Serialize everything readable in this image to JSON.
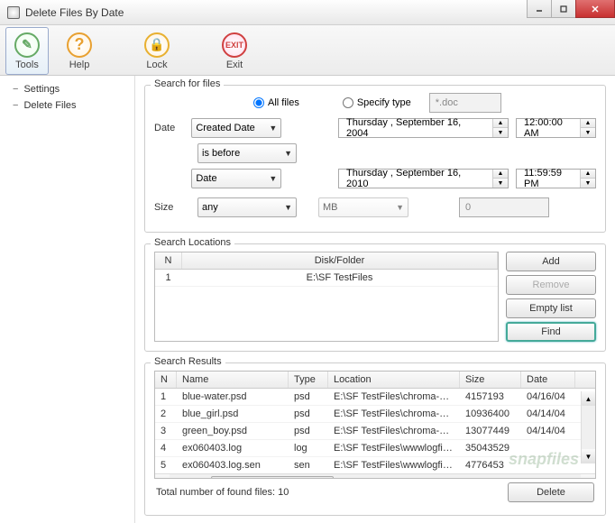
{
  "window": {
    "title": "Delete Files By Date"
  },
  "toolbar": {
    "tools": "Tools",
    "help": "Help",
    "lock": "Lock",
    "exit": "Exit",
    "help_glyph": "?",
    "exit_glyph": "EXIT"
  },
  "sidebar": {
    "settings": "Settings",
    "delete_files": "Delete Files"
  },
  "search": {
    "group_label": "Search for files",
    "radio_all": "All files",
    "radio_type": "Specify type",
    "type_value": "*.doc",
    "date_label": "Date",
    "date_field": "Created Date",
    "date_op": "is before",
    "date_mode": "Date",
    "date1": "Thursday , September 16, 2004",
    "time1": "12:00:00 AM",
    "date2": "Thursday , September 16, 2010",
    "time2": "11:59:59 PM",
    "size_label": "Size",
    "size_mode": "any",
    "size_unit": "MB",
    "size_value": "0"
  },
  "locations": {
    "group_label": "Search Locations",
    "col_n": "N",
    "col_path": "Disk/Folder",
    "rows": [
      {
        "n": "1",
        "path": "E:\\SF TestFiles"
      }
    ],
    "btn_add": "Add",
    "btn_remove": "Remove",
    "btn_empty": "Empty list",
    "btn_find": "Find"
  },
  "results": {
    "group_label": "Search Results",
    "col_n": "N",
    "col_name": "Name",
    "col_type": "Type",
    "col_loc": "Location",
    "col_size": "Size",
    "col_date": "Date",
    "rows": [
      {
        "n": "1",
        "name": "blue-water.psd",
        "type": "psd",
        "loc": "E:\\SF TestFiles\\chroma-sa...",
        "size": "4157193",
        "date": "04/16/04"
      },
      {
        "n": "2",
        "name": "blue_girl.psd",
        "type": "psd",
        "loc": "E:\\SF TestFiles\\chroma-sa...",
        "size": "10936400",
        "date": "04/14/04"
      },
      {
        "n": "3",
        "name": "green_boy.psd",
        "type": "psd",
        "loc": "E:\\SF TestFiles\\chroma-sa...",
        "size": "13077449",
        "date": "04/14/04"
      },
      {
        "n": "4",
        "name": "ex060403.log",
        "type": "log",
        "loc": "E:\\SF TestFiles\\wwwlogfiles\\",
        "size": "35043529",
        "date": ""
      },
      {
        "n": "5",
        "name": "ex060403.log.sen",
        "type": "sen",
        "loc": "E:\\SF TestFiles\\wwwlogfiles\\",
        "size": "4776453",
        "date": ""
      }
    ],
    "footer_text": "Total number of found files: 10",
    "btn_delete": "Delete"
  },
  "watermark": "snapfiles"
}
